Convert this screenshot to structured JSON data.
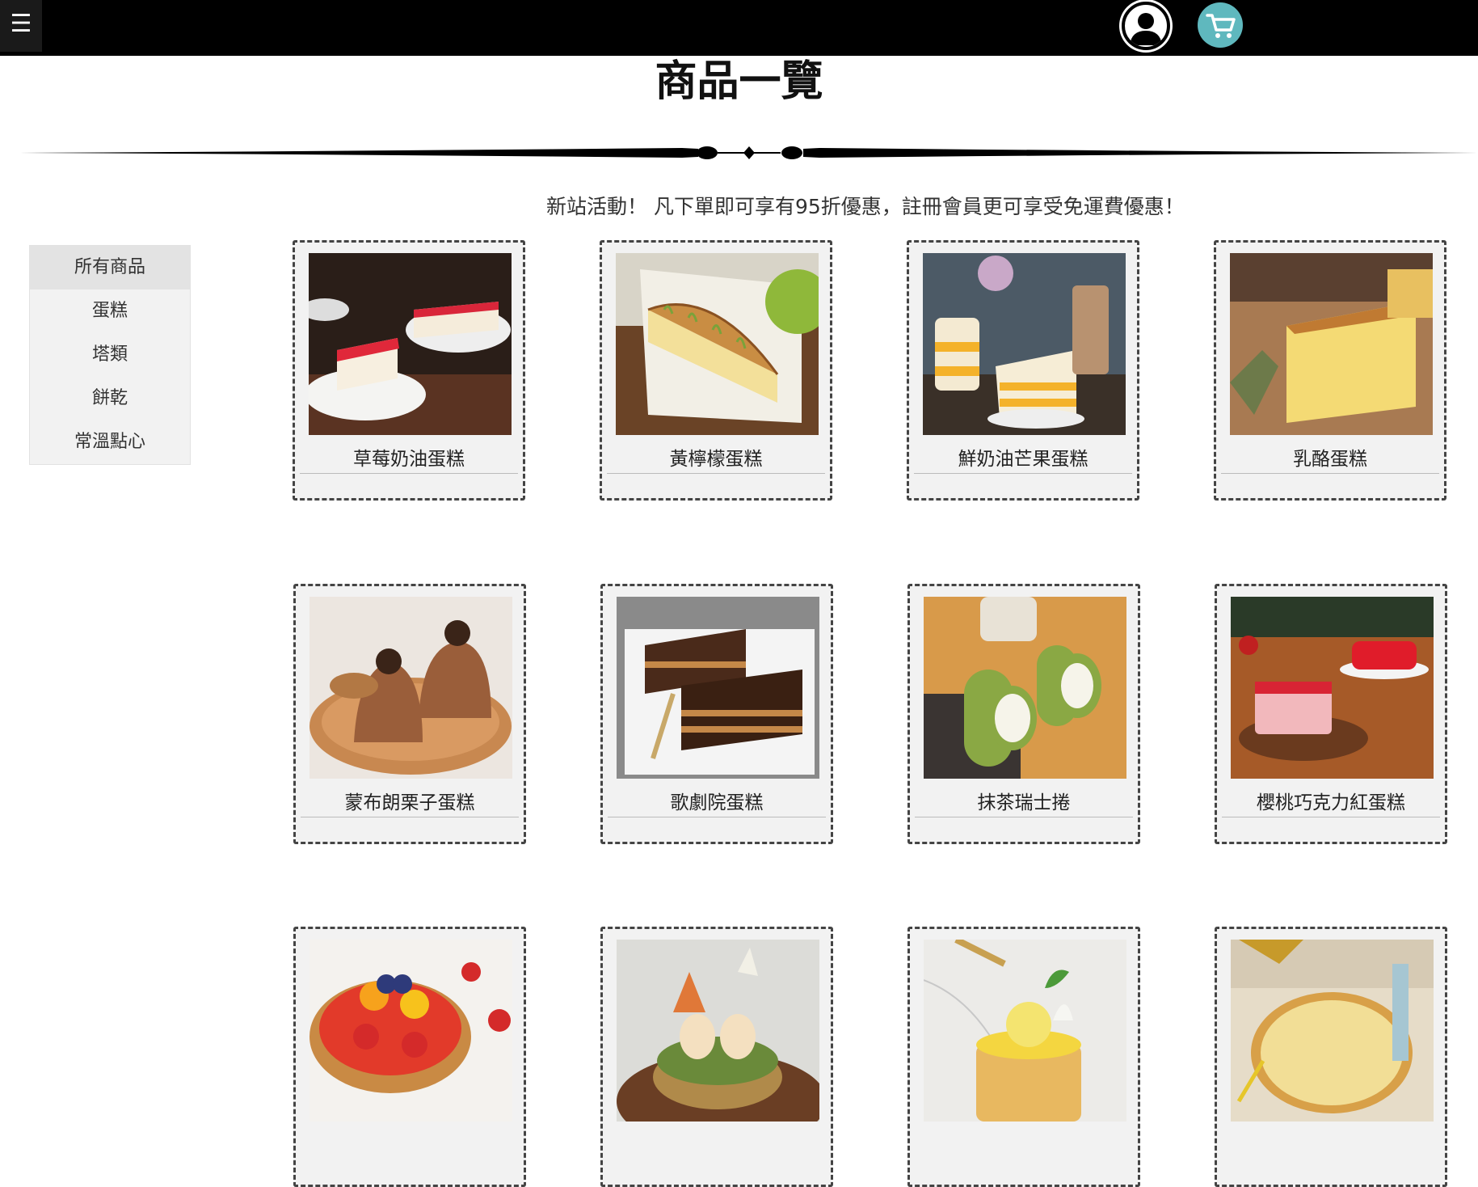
{
  "header": {
    "menu_icon": "☰",
    "user_icon": "user-circle-icon",
    "cart_icon": "shopping-cart-icon",
    "cart_color": "#5fb8be"
  },
  "page_title": "商品一覽",
  "promo_text": "新站活動！ 凡下單即可享有95折優惠，註冊會員更可享受免運費優惠！",
  "sidebar": {
    "items": [
      {
        "label": "所有商品",
        "active": true
      },
      {
        "label": "蛋糕",
        "active": false
      },
      {
        "label": "塔類",
        "active": false
      },
      {
        "label": "餅乾",
        "active": false
      },
      {
        "label": "常溫點心",
        "active": false
      }
    ]
  },
  "products": [
    {
      "name": "草莓奶油蛋糕"
    },
    {
      "name": "黃檸檬蛋糕"
    },
    {
      "name": "鮮奶油芒果蛋糕"
    },
    {
      "name": "乳酪蛋糕"
    },
    {
      "name": "蒙布朗栗子蛋糕"
    },
    {
      "name": "歌劇院蛋糕"
    },
    {
      "name": "抹茶瑞士捲"
    },
    {
      "name": "櫻桃巧克力紅蛋糕"
    },
    {
      "name": ""
    },
    {
      "name": ""
    },
    {
      "name": ""
    },
    {
      "name": ""
    }
  ]
}
